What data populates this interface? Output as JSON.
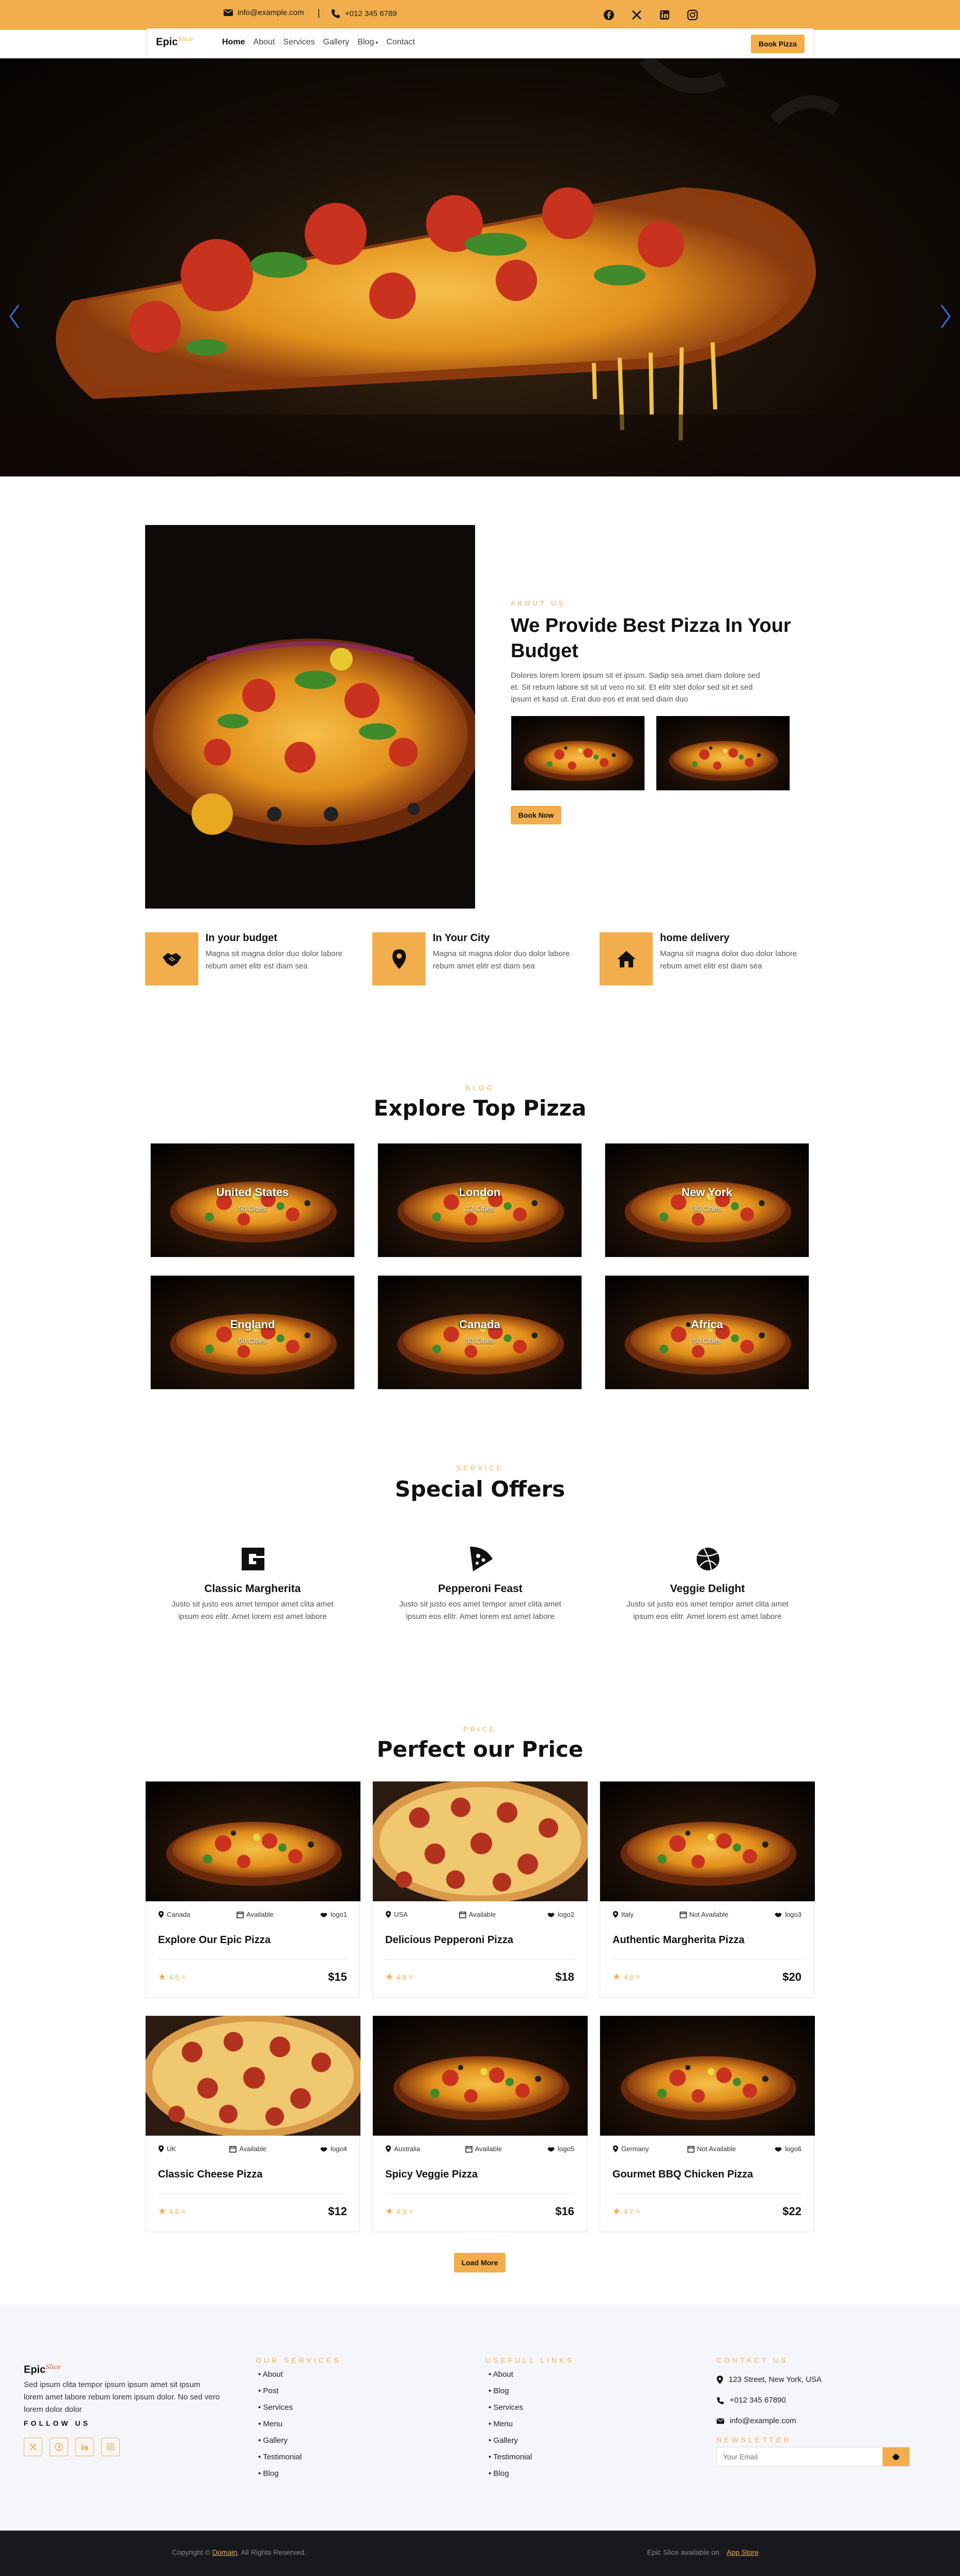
{
  "topbar": {
    "email": "info@example.com",
    "separator": "|",
    "phone": "+012 345 6789",
    "socials": [
      "facebook-icon",
      "x-icon",
      "linkedin-icon",
      "instagram-icon"
    ]
  },
  "nav": {
    "logo_main": "Epic",
    "logo_script": "Slice",
    "links": [
      "Home",
      "About",
      "Services",
      "Gallery",
      "Blog",
      "Contact"
    ],
    "cta": "Book Pizza"
  },
  "about": {
    "label": "ABOUT US",
    "title_line1": "We Provide Best Pizza In Your",
    "title_line2": "Budget",
    "text_line1": "Dolores lorem lorem ipsum sit et ipsum. Sadip sea amet diam dolore sed",
    "text_line2": "et. Sit rebum labore sit sit ut vero no sit. Et elitr stet dolor sed sit et sed",
    "text_line3": "ipsum et kasd ut. Erat duo eos et erat sed diam duo",
    "button": "Book Now"
  },
  "features": [
    {
      "icon": "handshake-icon",
      "title": "In your budget",
      "line1": "Magna sit magna dolor duo dolor labore",
      "line2": "rebum amet elitr est diam sea"
    },
    {
      "icon": "location-pin-icon",
      "title": "In Your City",
      "line1": "Magna sit magna dolor duo dolor labore",
      "line2": "rebum amet elitr est diam sea"
    },
    {
      "icon": "home-icon",
      "title": "home delivery",
      "line1": "Magna sit magna dolor duo dolor labore",
      "line2": "rebum amet elitr est diam sea"
    }
  ],
  "blog": {
    "label": "BLOG",
    "title": "Explore Top Pizza",
    "cities": [
      {
        "name": "United States",
        "sub": "50 Cities"
      },
      {
        "name": "London",
        "sub": "12 Cities"
      },
      {
        "name": "New York",
        "sub": "30 Cities"
      },
      {
        "name": "England",
        "sub": "50 Cities"
      },
      {
        "name": "Canada",
        "sub": "30 Cities"
      },
      {
        "name": "Africa",
        "sub": "50 Cities"
      }
    ]
  },
  "services": {
    "label": "SERVICE",
    "title": "Special Offers",
    "items": [
      {
        "icon": "google-logo-icon",
        "title": "Classic Margherita",
        "line1": "Justo sit justo eos amet tempor amet clita amet",
        "line2": "ipsum eos elitr. Amet lorem est amet labore"
      },
      {
        "icon": "pizza-slice-icon",
        "title": "Pepperoni Feast",
        "line1": "Justo sit justo eos amet tempor amet clita amet",
        "line2": "ipsum eos elitr. Amet lorem est amet labore"
      },
      {
        "icon": "dribbble-ball-icon",
        "title": "Veggie Delight",
        "line1": "Justo sit justo eos amet tempor amet clita amet",
        "line2": "ipsum eos elitr. Amet lorem est amet labore"
      }
    ]
  },
  "pricing": {
    "label": "PRICE",
    "title": "Perfect our Price",
    "cards": [
      {
        "location": "Canada",
        "status": "Available",
        "logo": "logo1",
        "title": "Explore Our Epic Pizza",
        "rating": "4.5",
        "rating_sup": "/5",
        "price": "$15"
      },
      {
        "location": "USA",
        "status": "Available",
        "logo": "logo2",
        "title": "Delicious Pepperoni Pizza",
        "rating": "4.8",
        "rating_sup": "/5",
        "price": "$18"
      },
      {
        "location": "Italy",
        "status": "Not Available",
        "logo": "logo3",
        "title": "Authentic Margherita Pizza",
        "rating": "4.8",
        "rating_sup": "/5",
        "price": "$20"
      },
      {
        "location": "UK",
        "status": "Available",
        "logo": "logo4",
        "title": "Classic Cheese Pizza",
        "rating": "4.6",
        "rating_sup": "/5",
        "price": "$12"
      },
      {
        "location": "Australia",
        "status": "Available",
        "logo": "logo5",
        "title": "Spicy Veggie Pizza",
        "rating": "4.3",
        "rating_sup": "/5",
        "price": "$16"
      },
      {
        "location": "Germany",
        "status": "Not Available",
        "logo": "logo6",
        "title": "Gourmet BBQ Chicken Pizza",
        "rating": "4.7",
        "rating_sup": "/5",
        "price": "$22"
      }
    ],
    "load_more": "Load More"
  },
  "footer": {
    "logo_main": "Epic",
    "logo_script": "Slice",
    "about_line1": "Sed ipsum clita tempor ipsum ipsum amet sit ipsum",
    "about_line2": "lorem amet labore rebum lorem ipsum dolor. No sed vero",
    "about_line3": "lorem dolor dolor",
    "follow": "FOLLOW US",
    "services_head": "OUR SERVICES",
    "services": [
      "About",
      "Post",
      "Services",
      "Menu",
      "Gallery",
      "Testimonial",
      "Blog"
    ],
    "links_head": "USEFULL LINKS",
    "links": [
      "About",
      "Blog",
      "Services",
      "Menu",
      "Gallery",
      "Testimonial",
      "Blog"
    ],
    "contact_head": "CONTACT US",
    "address": "123 Street, New York, USA",
    "phone": "+012 345 67890",
    "email": "info@example.com",
    "newsletter_head": "NEWSLETTER",
    "newsletter_placeholder": "Your Email"
  },
  "copyright": {
    "prefix": "Copyright ©",
    "domain": "Domain",
    "suffix": ", All Rights Reserved.",
    "app_text": "Epic Slice available on",
    "app_link": "App Store"
  },
  "colors": {
    "accent": "#f2ae4c",
    "dark": "#17191c",
    "footer_bg": "#f5f6fa"
  }
}
